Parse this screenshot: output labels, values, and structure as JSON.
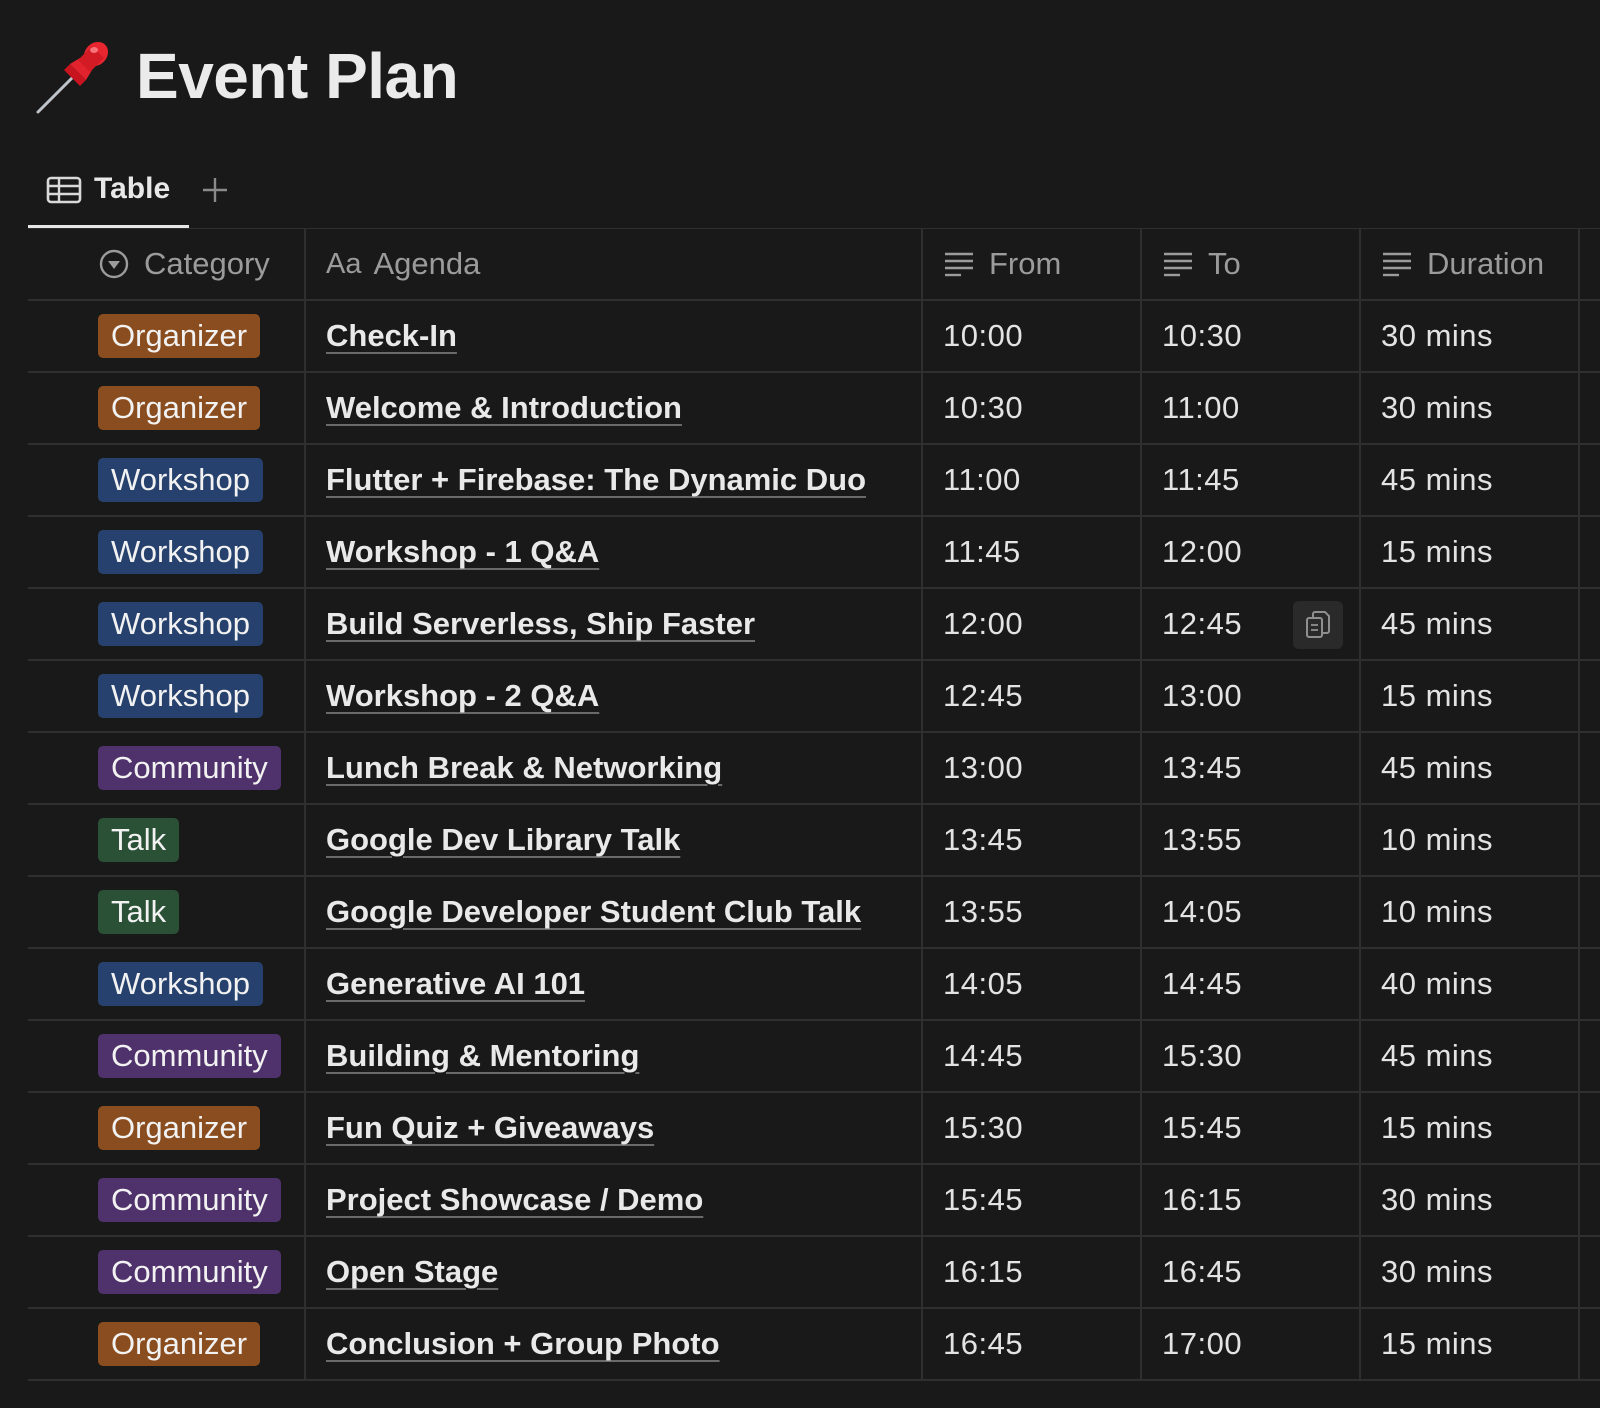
{
  "page": {
    "icon": "pushpin-icon",
    "title": "Event Plan"
  },
  "views": {
    "tabs": [
      {
        "label": "Table",
        "icon": "table-icon"
      }
    ],
    "add_icon": "plus-icon"
  },
  "table": {
    "columns": [
      {
        "key": "category",
        "label": "Category",
        "icon": "select-icon"
      },
      {
        "key": "agenda",
        "label": "Agenda",
        "icon": "title-aa-icon",
        "icon_text": "Aa"
      },
      {
        "key": "from",
        "label": "From",
        "icon": "text-lines-icon"
      },
      {
        "key": "to",
        "label": "To",
        "icon": "text-lines-icon"
      },
      {
        "key": "duration",
        "label": "Duration",
        "icon": "text-lines-icon"
      }
    ],
    "tag_colors": {
      "Organizer": "#8a4d1f",
      "Workshop": "#26416d",
      "Community": "#4f326b",
      "Talk": "#2a5136"
    },
    "rows": [
      {
        "category": "Organizer",
        "agenda": "Check-In",
        "from": "10:00",
        "to": "10:30",
        "duration": "30 mins"
      },
      {
        "category": "Organizer",
        "agenda": "Welcome & Introduction",
        "from": "10:30",
        "to": "11:00",
        "duration": "30 mins"
      },
      {
        "category": "Workshop",
        "agenda": "Flutter + Firebase: The Dynamic Duo",
        "from": "11:00",
        "to": "11:45",
        "duration": "45 mins"
      },
      {
        "category": "Workshop",
        "agenda": "Workshop - 1 Q&A",
        "from": "11:45",
        "to": "12:00",
        "duration": "15 mins"
      },
      {
        "category": "Workshop",
        "agenda": "Build Serverless, Ship Faster",
        "from": "12:00",
        "to": "12:45",
        "duration": "45 mins"
      },
      {
        "category": "Workshop",
        "agenda": "Workshop - 2 Q&A",
        "from": "12:45",
        "to": "13:00",
        "duration": "15 mins"
      },
      {
        "category": "Community",
        "agenda": "Lunch Break & Networking",
        "from": "13:00",
        "to": "13:45",
        "duration": "45 mins"
      },
      {
        "category": "Talk",
        "agenda": "Google Dev Library Talk",
        "from": "13:45",
        "to": "13:55",
        "duration": "10 mins"
      },
      {
        "category": "Talk",
        "agenda": "Google Developer Student Club Talk",
        "from": "13:55",
        "to": "14:05",
        "duration": "10 mins"
      },
      {
        "category": "Workshop",
        "agenda": "Generative AI 101",
        "from": "14:05",
        "to": "14:45",
        "duration": "40 mins"
      },
      {
        "category": "Community",
        "agenda": "Building & Mentoring",
        "from": "14:45",
        "to": "15:30",
        "duration": "45 mins"
      },
      {
        "category": "Organizer",
        "agenda": "Fun Quiz + Giveaways",
        "from": "15:30",
        "to": "15:45",
        "duration": "15 mins"
      },
      {
        "category": "Community",
        "agenda": "Project Showcase / Demo",
        "from": "15:45",
        "to": "16:15",
        "duration": "30 mins"
      },
      {
        "category": "Community",
        "agenda": "Open Stage",
        "from": "16:15",
        "to": "16:45",
        "duration": "30 mins"
      },
      {
        "category": "Organizer",
        "agenda": "Conclusion + Group Photo",
        "from": "16:45",
        "to": "17:00",
        "duration": "15 mins"
      }
    ],
    "hover_copy": {
      "row": 4,
      "column": "to",
      "icon": "copy-icon"
    }
  }
}
